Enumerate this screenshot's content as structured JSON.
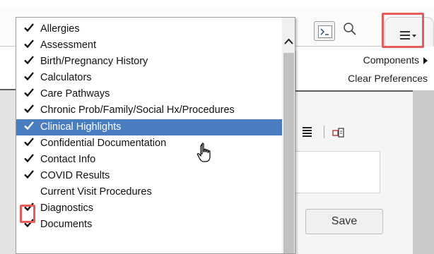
{
  "colors": {
    "selection": "#4a7cc0",
    "callout": "#e85a5a"
  },
  "toolbar": {
    "terminal_icon": "terminal-icon",
    "search_icon": "search-icon",
    "menu_icon": "menu-icon"
  },
  "submenu": {
    "items": [
      {
        "label": "Components",
        "has_submenu": true
      },
      {
        "label": "Clear Preferences",
        "has_submenu": false
      }
    ]
  },
  "components_list": {
    "items": [
      {
        "label": "Allergies",
        "checked": true
      },
      {
        "label": "Assessment",
        "checked": true
      },
      {
        "label": "Birth/Pregnancy History",
        "checked": true
      },
      {
        "label": "Calculators",
        "checked": true
      },
      {
        "label": "Care Pathways",
        "checked": true
      },
      {
        "label": "Chronic Prob/Family/Social Hx/Procedures",
        "checked": true
      },
      {
        "label": "Clinical Highlights",
        "checked": true,
        "selected": true
      },
      {
        "label": "Confidential Documentation",
        "checked": true
      },
      {
        "label": "Contact Info",
        "checked": true
      },
      {
        "label": "COVID Results",
        "checked": true
      },
      {
        "label": "Current Visit Procedures",
        "checked": false
      },
      {
        "label": "Diagnostics",
        "checked": true
      },
      {
        "label": "Documents",
        "checked": true
      }
    ]
  },
  "editor": {
    "save_label": "Save"
  }
}
